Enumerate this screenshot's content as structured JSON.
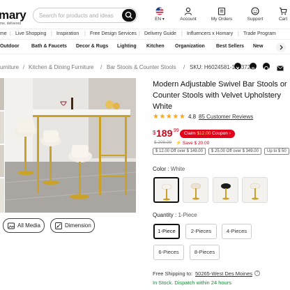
{
  "header": {
    "logo": "mary",
    "tagline": "me, delivered",
    "search_placeholder": "Search for products and ideas",
    "icons": [
      {
        "name": "us-flag-icon",
        "label": "EN"
      },
      {
        "name": "user-icon",
        "label": "Account"
      },
      {
        "name": "orders-icon",
        "label": "My Orders"
      },
      {
        "name": "support-icon",
        "label": "Support"
      },
      {
        "name": "cart-icon",
        "label": "Cart"
      }
    ]
  },
  "nav1": [
    "me",
    "Live Shopping",
    "Inspiration",
    "Free Design Services",
    "Delivery Guide",
    "Influencers x Homary",
    "Trade Program"
  ],
  "nav2": [
    "Outdoor",
    "Bath & Faucets",
    "Decor & Rugs",
    "Lighting",
    "Kitchen",
    "Organization",
    "Best Sellers",
    "New"
  ],
  "breadcrumb": {
    "items": [
      "urniture",
      "Kitchen & Dining Furniture",
      "Bar Stools & Counter Stools"
    ],
    "sku": "SKU: H6024581-18437287"
  },
  "media_buttons": {
    "all_media": "All Media",
    "dimension": "Dimension"
  },
  "product": {
    "title": "Modern Adjustable Swivel Bar Stools or Counter Stools with Velvet Upholstery White",
    "stars": "★★★★★",
    "rating": "4.8",
    "reviews": "85 Customer Reviews",
    "currency": "$",
    "price_whole": "189",
    "price_cents": ".99",
    "coupon_prefix": "Claim",
    "coupon_amount": "$12.00",
    "coupon_suffix": "Coupon ›",
    "old_price": "$ 209.99",
    "save": "⚡ Save $ 20.00",
    "offers": [
      "$ 12.00 Off over $ 149.00",
      "$ 25.00 Off over $ 349.00",
      "Up to $ 50"
    ],
    "color_label": "Color :",
    "color_value": "White",
    "quantity_label": "Quantity :",
    "quantity_value": "1-Piece",
    "quantities": [
      "1-Piece",
      "2-Pieces",
      "4-Pieces",
      "6-Pieces",
      "8-Pieces"
    ],
    "selected_quantity_index": 0,
    "shipping_label": "Free Shipping to:",
    "shipping_location": "50265-West Des Moines",
    "stock": "In Stock. Dispatch within 24 hours"
  },
  "colors": {
    "accent_red": "#d0021b",
    "gold": "#c9a227",
    "stock_green": "#1a8a3a"
  }
}
